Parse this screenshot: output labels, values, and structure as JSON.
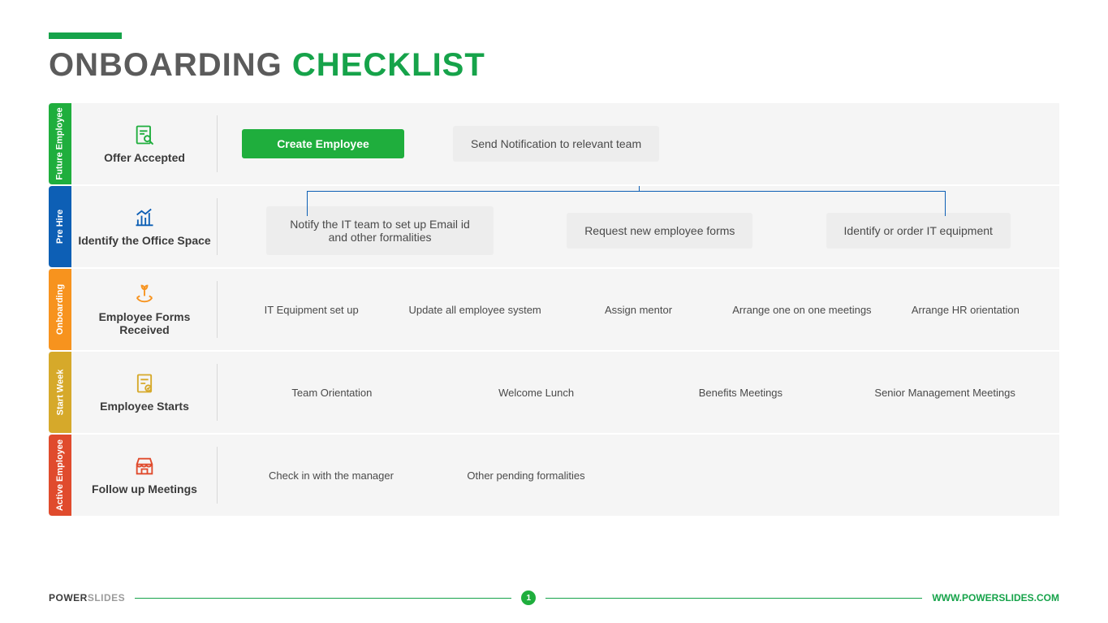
{
  "title": {
    "part1": "ONBOARDING",
    "part2": "CHECKLIST"
  },
  "rows": [
    {
      "tab": "Future Employee",
      "stage": "Offer Accepted",
      "tasks": [
        "Create Employee",
        "Send Notification to relevant team"
      ]
    },
    {
      "tab": "Pre Hire",
      "stage": "Identify the Office Space",
      "tasks": [
        "Notify the IT team to set up Email id and other formalities",
        "Request new employee forms",
        "Identify or order IT equipment"
      ]
    },
    {
      "tab": "Onboarding",
      "stage": "Employee Forms Received",
      "tasks": [
        "IT Equipment set up",
        "Update all employee system",
        "Assign mentor",
        "Arrange one on one meetings",
        "Arrange HR orientation"
      ]
    },
    {
      "tab": "Start Week",
      "stage": "Employee Starts",
      "tasks": [
        "Team Orientation",
        "Welcome Lunch",
        "Benefits Meetings",
        "Senior Management Meetings"
      ]
    },
    {
      "tab": "Active Employee",
      "stage": "Follow up Meetings",
      "tasks": [
        "Check in with the manager",
        "Other pending formalities"
      ]
    }
  ],
  "footer": {
    "brand1": "POWER",
    "brand2": "SLIDES",
    "url": "WWW.POWERSLIDES.COM",
    "page": "1"
  }
}
